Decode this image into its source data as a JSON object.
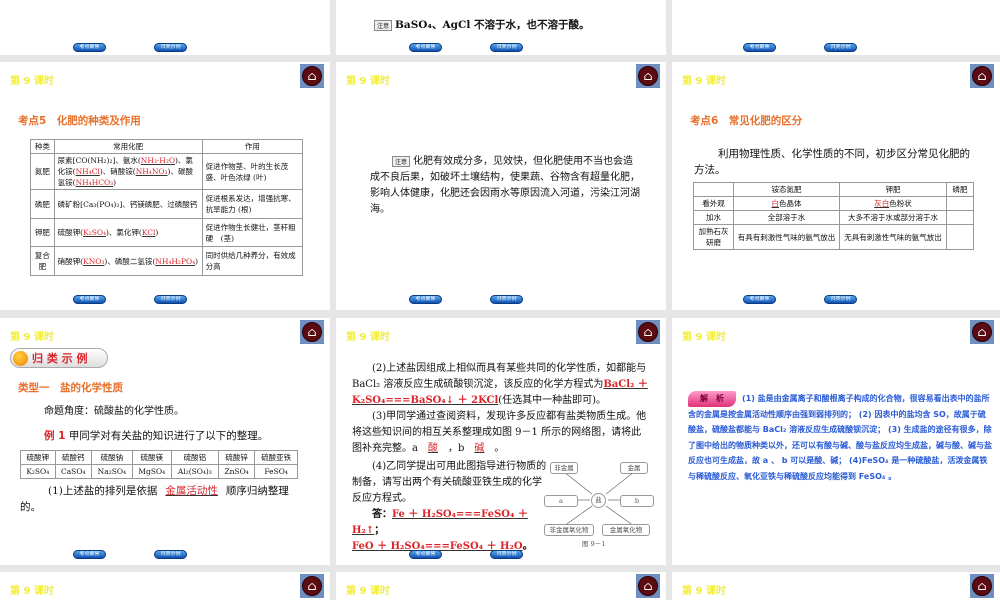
{
  "common": {
    "lesson": "第 9 课时",
    "btn1": "考点聚焦",
    "btn2": "归类示例"
  },
  "s0b": {
    "note_label": "注意",
    "note": "BaSO₄、AgCl 不溶于水，也不溶于酸。"
  },
  "s1": {
    "title": "考点5　化肥的种类及作用",
    "headers": [
      "种类",
      "常用化肥",
      "作用"
    ],
    "rows": [
      {
        "type": "氮肥",
        "text1": "尿素[CO(NH₂)₂]、氨水(",
        "a1": "NH₃·H₂O",
        "text2": ")、氯化铵(",
        "a2": "NH₄Cl",
        "text3": ")、硝酸铵(",
        "a3": "NH₄NO₃",
        "text4": ")、碳酸氢铵(",
        "a4": "NH₄HCO₃",
        "text5": ")",
        "effect": "促进作物茎、叶的生长茂盛、叶色浓绿 (叶)"
      },
      {
        "type": "磷肥",
        "text1": "磷矿粉[Ca₃(PO₄)₂]、钙镁磷肥、过磷酸钙",
        "effect": "促进根系发达，增强抗寒、抗旱能力 (根)"
      },
      {
        "type": "钾肥",
        "text1": "硫酸钾(",
        "a1": "K₂SO₄",
        "text2": ")、氯化钾(",
        "a2": "KCl",
        "text3": ")",
        "effect": "促进作物生长健壮，茎秆粗硬　(茎)"
      },
      {
        "type": "复合肥",
        "text1": "硝酸钾(",
        "a1": "KNO₃",
        "text2": ")、磷酸二氢铵(",
        "a2": "NH₄H₂PO₄",
        "text3": ")",
        "effect": "同时供给几种养分，有效成分高"
      }
    ]
  },
  "s2": {
    "note_label": "注意",
    "note": "化肥有效成分多，见效快，但化肥使用不当也会造成不良后果，如破坏土壤结构，使果蔬、谷物含有超量化肥，影响人体健康，化肥还会因雨水等原因流入河道，污染江河湖海。"
  },
  "s3": {
    "title": "考点6　常见化肥的区分",
    "intro": "利用物理性质、化学性质的不同，初步区分常见化肥的方法。",
    "headers": [
      "",
      "铵态氮肥",
      "钾肥",
      "磷肥"
    ],
    "rows": [
      {
        "label": "看外观",
        "c1a": "白",
        "c1b": "色晶体",
        "c2a": "灰白",
        "c2b": "色粉状"
      },
      {
        "label": "加水",
        "c1": "全部溶于水",
        "c2": "大多不溶于水或部分溶于水"
      },
      {
        "label": "加熟石灰研磨",
        "c1": "有具有刺激性气味的氨气放出",
        "c2": "无具有刺激性气味的氨气放出"
      }
    ]
  },
  "s4": {
    "banner": "归 类 示 例",
    "type": "类型一　盐的化学性质",
    "angle": "命题角度：硫酸盐的化学性质。",
    "ex_label": "例 1",
    "ex": "甲同学对有关盐的知识进行了以下的整理。",
    "names": [
      "硫酸钾",
      "硫酸钙",
      "硫酸钠",
      "硫酸镁",
      "硫酸铝",
      "硫酸锌",
      "硫酸亚铁"
    ],
    "formulas": [
      "K₂SO₄",
      "CaSO₄",
      "Na₂SO₄",
      "MgSO₄",
      "Al₂(SO₄)₃",
      "ZnSO₄",
      "FeSO₄"
    ],
    "q1a": "(1)上述盐的排列是依据",
    "q1ans": "金属活动性",
    "q1b": "顺序归纳整理的。"
  },
  "s5": {
    "q2": "(2)上述盐因组成上相似而具有某些共同的化学性质，如都能与 BaCl₂ 溶液反应生成硫酸钡沉淀，该反应的化学方程式为",
    "q2ans": "BaCl₂ ＋ K₂SO₄===BaSO₄↓ ＋ 2KCl",
    "q2b": "(任选其中一种盐即可)。",
    "q3": "(3)甲同学通过查阅资料，发现许多反应都有盐类物质生成。他将这些知识间的相互关系整理成如图 9－1 所示的网络图，请将此图补充完整。a",
    "q3a": "酸",
    "q3mid": "，b",
    "q3b": "碱",
    "q3end": "。",
    "q4": "(4)乙同学提出可用此图指导进行物质的制备，请写出两个有关硫酸亚铁生成的化学反应方程式。",
    "ans_label": "答：",
    "ans1": "Fe ＋ H₂SO₄===FeSO₄ ＋ H₂↑",
    "ans2": "FeO ＋ H₂SO₄===FeSO₄ ＋ H₂O",
    "diagram": {
      "center": "盐",
      "nodes": [
        "非金属",
        "金属",
        "a",
        "b",
        "非金属氧化物",
        "金属氧化物"
      ],
      "caption": "图 9－1"
    }
  },
  "s6": {
    "label": "解　析",
    "text": "(1) 盐是由金属离子和酸根离子构成的化合物，很容易看出表中的盐所含的金属是按金属活动性顺序由强到弱排列的； (2) 因表中的盐均含 SO，故属于硫酸盐，硫酸盐都能与 BaCl₂ 溶液反应生成硫酸钡沉淀； (3) 生成盐的途径有很多，除了图中给出的物质种类以外，还可以有酸与碱、酸与盐反应均生成盐，碱与酸、碱与盐反应也可生成盐，故 a 、 b 可以是酸、碱； (4)FeSO₄ 是一种硫酸盐，活泼金属铁与稀硫酸反应、氧化亚铁与稀硫酸反应均能得到 FeSO₄ 。"
  }
}
